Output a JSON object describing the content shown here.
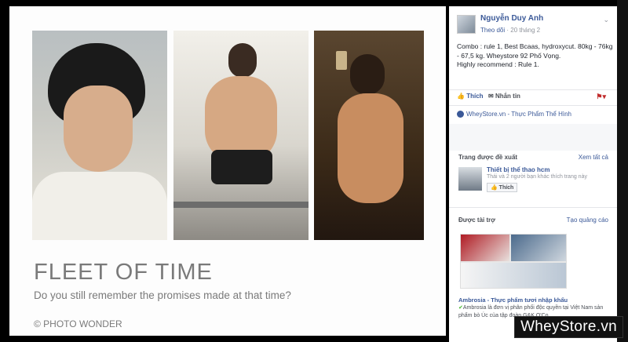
{
  "collage": {
    "title": "FLEET OF TIME",
    "subtitle": "Do you still remember the promises made at that time?",
    "credit": "© PHOTO WONDER"
  },
  "post": {
    "author": "Nguyễn Duy Anh",
    "follow": "Theo dõi",
    "time": "20 tháng 2",
    "text_line1": "Combo : rule 1, Best Bcaas, hydroxycut. 80kg - 76kg - 67,5 kg. Wheystore 92 Phố Vọng.",
    "text_line2": "Highly recommend : Rule 1.",
    "like_label": "Thích",
    "message_label": "Nhắn tin",
    "page_link": "WheyStore.vn - Thực Phẩm Thể Hình"
  },
  "suggested": {
    "heading": "Trang được đề xuất",
    "see_all": "Xem tất cả",
    "title": "Thiết bị thể thao hcm",
    "meta": "Thái và 2 người bạn khác thích trang này",
    "like_button": "Thích"
  },
  "sponsored": {
    "heading": "Được tài trợ",
    "create_ad": "Tạo quảng cáo",
    "title": "Ambrosia - Thực phẩm tươi nhập khẩu",
    "desc": "Ambrosia là đơn vị phân phối độc quyền tại Việt Nam sản phẩm bò Úc của tập đoàn G&K O'Co..."
  },
  "watermark": "WheyStore.vn",
  "colors": {
    "link": "#3b5998",
    "text": "#1d2129",
    "muted": "#90949c"
  }
}
